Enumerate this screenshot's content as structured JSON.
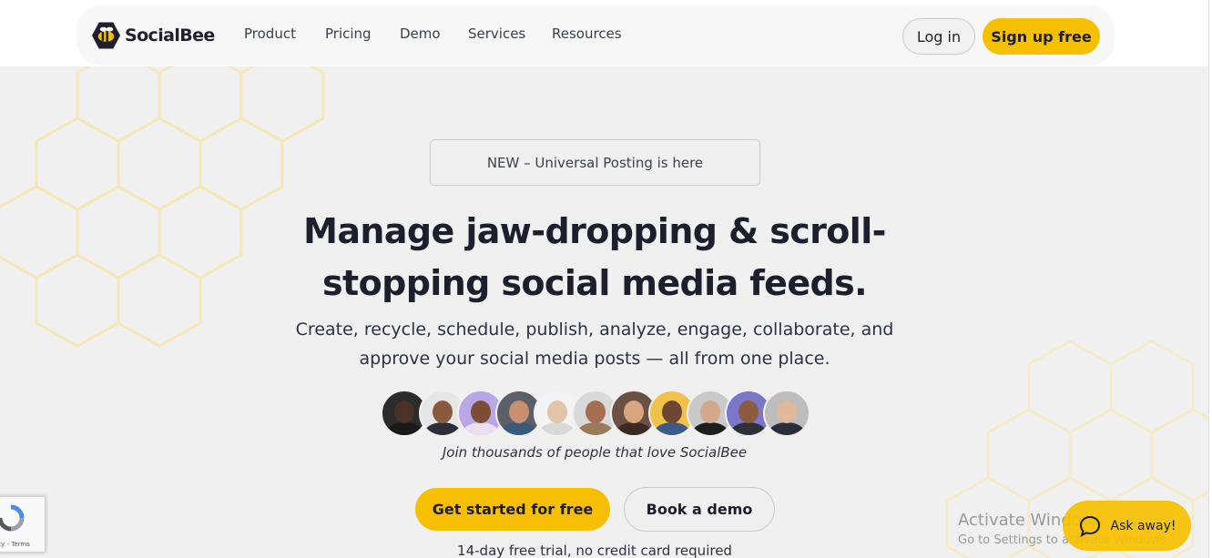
{
  "brand": {
    "name": "SocialBee",
    "accent_color": "#f6c000",
    "dark_color": "#1d1f2c"
  },
  "nav": {
    "items": [
      {
        "label": "Product"
      },
      {
        "label": "Pricing"
      },
      {
        "label": "Demo"
      },
      {
        "label": "Services"
      },
      {
        "label": "Resources"
      }
    ],
    "login_label": "Log in",
    "signup_label": "Sign up free"
  },
  "hero": {
    "announcement": "NEW – Universal Posting is here",
    "headline_line1": "Manage jaw-dropping & scroll-",
    "headline_line2": "stopping social media feeds.",
    "subline_line1": "Create, recycle, schedule, publish, analyze, engage, collaborate, and",
    "subline_line2": "approve your social media posts — all from one place.",
    "avatars": [
      {
        "name": "avatar-1",
        "bg": "#2b2b2b",
        "skin": "#4a3227",
        "shirt": "#1a1a1a"
      },
      {
        "name": "avatar-2",
        "bg": "#e6e6e6",
        "skin": "#8a5a3e",
        "shirt": "#2a2f3a"
      },
      {
        "name": "avatar-3",
        "bg": "#b9a6e6",
        "skin": "#7a4d34",
        "shirt": "#e9e0f2"
      },
      {
        "name": "avatar-4",
        "bg": "#5b6068",
        "skin": "#c89070",
        "shirt": "#3a5a7a"
      },
      {
        "name": "avatar-5",
        "bg": "#f3f3f3",
        "skin": "#e2c4a8",
        "shirt": "#d8d8d8"
      },
      {
        "name": "avatar-6",
        "bg": "#d9d9d9",
        "skin": "#a56e52",
        "shirt": "#9a7a5a"
      },
      {
        "name": "avatar-7",
        "bg": "#6b5044",
        "skin": "#d7a57e",
        "shirt": "#3a2a22"
      },
      {
        "name": "avatar-8",
        "bg": "#f0c24b",
        "skin": "#6f4632",
        "shirt": "#3c5a8a"
      },
      {
        "name": "avatar-9",
        "bg": "#c9c9c9",
        "skin": "#d2a98a",
        "shirt": "#1e1e1e"
      },
      {
        "name": "avatar-10",
        "bg": "#7a77c8",
        "skin": "#8c5a3f",
        "shirt": "#2f3138"
      },
      {
        "name": "avatar-11",
        "bg": "#bdbdbd",
        "skin": "#e0b89a",
        "shirt": "#2a2e3a"
      }
    ],
    "tagline": "Join thousands of people that love SocialBee",
    "primary_cta": "Get started for free",
    "secondary_cta": "Book a demo",
    "trial_note": "14-day free trial, no credit card required"
  },
  "recaptcha": {
    "links": "acy - Terms"
  },
  "windows_watermark": {
    "title": "Activate Windows",
    "subtitle": "Go to Settings to activate Windows."
  },
  "chat": {
    "label": "Ask away!"
  }
}
